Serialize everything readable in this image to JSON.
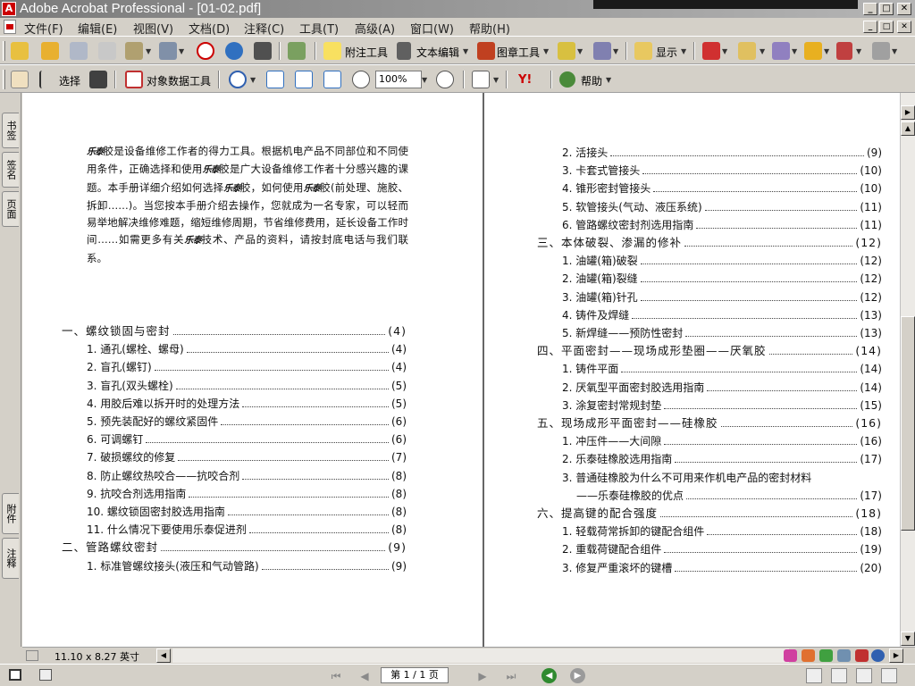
{
  "window": {
    "title": "Adobe Acrobat Professional - [01-02.pdf]",
    "app_icon_glyph": "A",
    "minimize": "_",
    "maximize": "□",
    "close": "✕",
    "other_app_texts": [
      "",
      "",
      ""
    ]
  },
  "menu": {
    "items": [
      "文件(F)",
      "编辑(E)",
      "视图(V)",
      "文档(D)",
      "注释(C)",
      "工具(T)",
      "高级(A)",
      "窗口(W)",
      "帮助(H)"
    ],
    "doc_min": "_",
    "doc_restore": "□",
    "doc_close": "✕"
  },
  "toolbar1": {
    "comment_tools": "附注工具",
    "text_edit": "文本编辑",
    "stamp_tools": "图章工具",
    "show": "显示"
  },
  "toolbar2": {
    "select": "选择",
    "object_data": "对象数据工具",
    "zoom_value": "100%",
    "yahoo": "Y!",
    "help": "帮助"
  },
  "nav_tabs": {
    "bookmarks": "书签",
    "signatures": "签名",
    "pages": "页面",
    "attachments": "附件",
    "comments": "注释"
  },
  "document": {
    "brand": "乐泰",
    "intro": [
      {
        "b": true,
        "t": "乐泰"
      },
      {
        "t": "胶是设备维修工作者的得力工具。根据机电产品不同部位和不同使用条件，正确选择和使用"
      },
      {
        "b": true,
        "t": "乐泰"
      },
      {
        "t": "胶是广大设备维修工作者十分感兴趣的课题。本手册详细介绍如何选择"
      },
      {
        "b": true,
        "t": "乐泰"
      },
      {
        "t": "胶，如何使用"
      },
      {
        "b": true,
        "t": "乐泰"
      },
      {
        "t": "胶(前处理、施胶、拆卸……)。当您按本手册介绍去操作，您就成为一名专家，可以轻而易举地解决维修难题，缩短维修周期，节省维修费用，延长设备工作时间……如需更多有关"
      },
      {
        "b": true,
        "t": "乐泰"
      },
      {
        "t": "技术、产品的资料，请按封底电话与我们联系。"
      }
    ],
    "toc_left": [
      {
        "title": "一、螺纹锁固与密封",
        "page": "(4)",
        "level": 0
      },
      {
        "title": "1. 通孔(螺栓、螺母)",
        "page": "(4)",
        "level": 1
      },
      {
        "title": "2. 盲孔(螺钉)",
        "page": "(4)",
        "level": 1
      },
      {
        "title": "3. 盲孔(双头螺栓)",
        "page": "(5)",
        "level": 1
      },
      {
        "title": "4. 用胶后难以拆开时的处理方法",
        "page": "(5)",
        "level": 1
      },
      {
        "title": "5. 预先装配好的螺纹紧固件",
        "page": "(6)",
        "level": 1
      },
      {
        "title": "6. 可调螺钉",
        "page": "(6)",
        "level": 1
      },
      {
        "title": "7. 破损螺纹的修复",
        "page": "(7)",
        "level": 1
      },
      {
        "title": "8. 防止螺纹热咬合——抗咬合剂",
        "page": "(8)",
        "level": 1
      },
      {
        "title": "9. 抗咬合剂选用指南",
        "page": "(8)",
        "level": 1
      },
      {
        "title": "10. 螺纹锁固密封胶选用指南",
        "page": "(8)",
        "level": 1
      },
      {
        "title": "11. 什么情况下要使用乐泰促进剂",
        "page": "(8)",
        "level": 1
      },
      {
        "title": "二、管路螺纹密封",
        "page": "(9)",
        "level": 0
      },
      {
        "title": "1. 标准管螺纹接头(液压和气动管路)",
        "page": "(9)",
        "level": 1
      }
    ],
    "toc_right": [
      {
        "title": "2. 活接头",
        "page": "(9)",
        "level": 1
      },
      {
        "title": "3. 卡套式管接头",
        "page": "(10)",
        "level": 1
      },
      {
        "title": "4. 锥形密封管接头",
        "page": "(10)",
        "level": 1
      },
      {
        "title": "5. 软管接头(气动、液压系统)",
        "page": "(11)",
        "level": 1
      },
      {
        "title": "6. 管路螺纹密封剂选用指南",
        "page": "(11)",
        "level": 1
      },
      {
        "title": "三、本体破裂、渗漏的修补",
        "page": "(12)",
        "level": 0
      },
      {
        "title": "1. 油罐(箱)破裂",
        "page": "(12)",
        "level": 1
      },
      {
        "title": "2. 油罐(箱)裂缝",
        "page": "(12)",
        "level": 1
      },
      {
        "title": "3. 油罐(箱)针孔",
        "page": "(12)",
        "level": 1
      },
      {
        "title": "4. 铸件及焊缝",
        "page": "(13)",
        "level": 1
      },
      {
        "title": "5. 新焊缝——预防性密封",
        "page": "(13)",
        "level": 1
      },
      {
        "title": "四、平面密封——现场成形垫圈——厌氧胶",
        "page": "(14)",
        "level": 0
      },
      {
        "title": "1. 铸件平面",
        "page": "(14)",
        "level": 1
      },
      {
        "title": "2. 厌氧型平面密封胶选用指南",
        "page": "(14)",
        "level": 1
      },
      {
        "title": "3. 涂复密封常规封垫",
        "page": "(15)",
        "level": 1
      },
      {
        "title": "五、现场成形平面密封——硅橡胶",
        "page": "(16)",
        "level": 0
      },
      {
        "title": "1. 冲压件——大间隙",
        "page": "(16)",
        "level": 1
      },
      {
        "title": "2. 乐泰硅橡胶选用指南",
        "page": "(17)",
        "level": 1
      },
      {
        "title": "3. 普通硅橡胶为什么不可用来作机电产品的密封材料",
        "page": "",
        "level": 1
      },
      {
        "title": "——乐泰硅橡胶的优点",
        "page": "(17)",
        "level": 2
      },
      {
        "title": "六、提高键的配合强度",
        "page": "(18)",
        "level": 0
      },
      {
        "title": "1. 轻载荷常拆卸的键配合组件",
        "page": "(18)",
        "level": 1
      },
      {
        "title": "2. 重载荷键配合组件",
        "page": "(19)",
        "level": 1
      },
      {
        "title": "3. 修复严重滚坏的键槽",
        "page": "(20)",
        "level": 1
      }
    ]
  },
  "bottom": {
    "page_size": "11.10 x 8.27 英寸",
    "page_indicator": "第 1 / 1 页"
  },
  "colors": {
    "brand_red": "#cc0000",
    "acrobat_title_gray": "#8a8a8a"
  }
}
